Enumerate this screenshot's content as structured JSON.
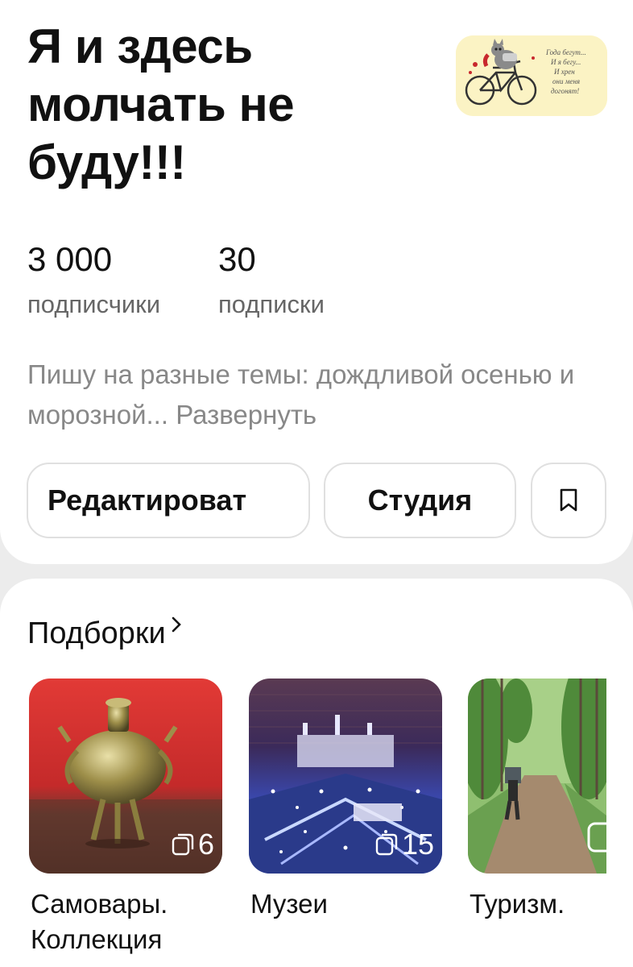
{
  "profile": {
    "title": "Я и здесь молчать не буду!!!",
    "avatar_text": [
      "Года бегут...",
      "И я бегу...",
      "И хрен",
      "они меня",
      "догонят!"
    ]
  },
  "stats": {
    "subscribers_count": "3 000",
    "subscribers_label": "подписчики",
    "subscriptions_count": "30",
    "subscriptions_label": "подписки"
  },
  "description": {
    "text": "Пишу на разные темы: дождливой осенью и морозной...",
    "expand_label": "Развернуть"
  },
  "buttons": {
    "edit_label": "Редактироват",
    "studio_label": "Студия",
    "save_icon": "bookmark-icon"
  },
  "collections": {
    "title": "Подборки",
    "items": [
      {
        "name": "Самовары. Коллекция",
        "count": "6",
        "image": "brass-samovar-on-red"
      },
      {
        "name": "Музеи",
        "count": "15",
        "image": "illuminated-kremlin-model"
      },
      {
        "name": "Туризм.",
        "count": "",
        "image": "hiker-on-forest-road"
      }
    ]
  },
  "colors": {
    "background": "#ececec",
    "card": "#ffffff",
    "text_primary": "#111111",
    "text_secondary": "#666666",
    "text_muted": "#888888",
    "border": "#e0e0e0"
  }
}
